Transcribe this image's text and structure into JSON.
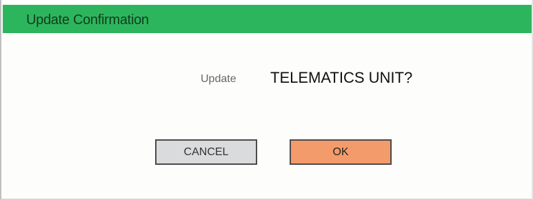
{
  "dialog": {
    "title": "Update Confirmation",
    "message": {
      "verb": "Update",
      "target": "TELEMATICS UNIT?"
    },
    "buttons": {
      "cancel_label": "CANCEL",
      "ok_label": "OK"
    }
  },
  "colors": {
    "titlebar": "#2db55d",
    "ok_button": "#f49b6b",
    "cancel_button": "#d9dbdc"
  }
}
